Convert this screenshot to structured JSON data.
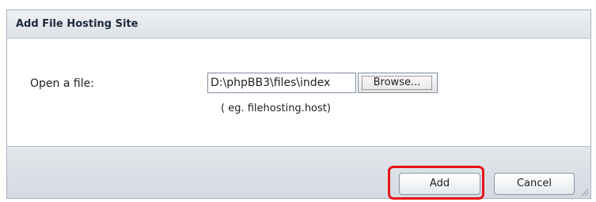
{
  "dialog": {
    "title": "Add File Hosting Site"
  },
  "form": {
    "label": "Open a file:",
    "file_value": "D:\\phpBB3\\files\\index",
    "browse_label": "Browse...",
    "hint": "( eg. filehosting.host)"
  },
  "footer": {
    "add_label": "Add",
    "cancel_label": "Cancel"
  },
  "colors": {
    "highlight": "#e8141b"
  }
}
